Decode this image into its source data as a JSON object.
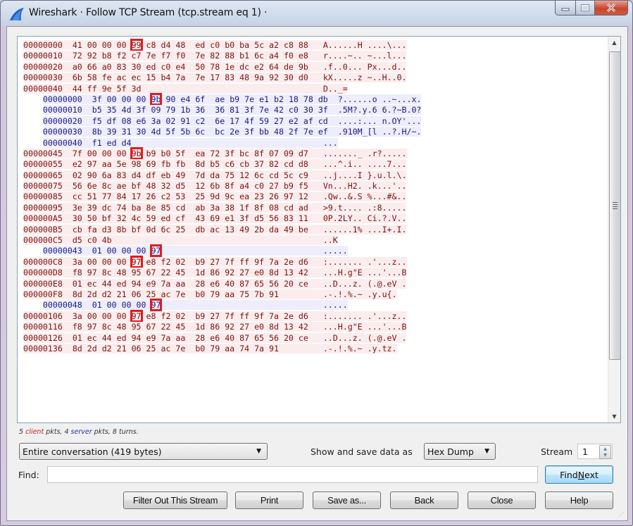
{
  "window": {
    "title": "Wireshark · Follow TCP Stream (tcp.stream eq 1) ·",
    "controls": {
      "minimize": "minimize",
      "maximize": "maximize",
      "close": "close"
    }
  },
  "colors": {
    "client_bg": "#fbeded",
    "client_text": "#7f1010",
    "server_bg": "#ededfb",
    "server_text": "#1a1a80",
    "highlight_box": "#e11b22"
  },
  "dump": {
    "lines": [
      {
        "side": "client",
        "offset": "00000000",
        "hex_pre": "41 00 00 00 ",
        "hl": "99",
        "hex_post": " c8 d4 48  ed c0 b0 ba 5c a2 c8 88",
        "ascii": "A......H ....\\..."
      },
      {
        "side": "client",
        "offset": "00000010",
        "hex_pre": "72 92 b8 f2 c7 7e f7 f0  7e 82 88 b1 6c a4 f0 e8",
        "hl": "",
        "hex_post": "",
        "ascii": "r....~.. ~...l..."
      },
      {
        "side": "client",
        "offset": "00000020",
        "hex_pre": "a0 66 a0 83 30 ed c0 e4  50 78 1e dc e2 64 de 9b",
        "hl": "",
        "hex_post": "",
        "ascii": ".f..0... Px...d.."
      },
      {
        "side": "client",
        "offset": "00000030",
        "hex_pre": "6b 58 fe ac ec 15 b4 7a  7e 17 83 48 9a 92 30 d0",
        "hl": "",
        "hex_post": "",
        "ascii": "kX.....z ~..H..0."
      },
      {
        "side": "client",
        "offset": "00000040",
        "hex_pre": "44 ff 9e 5f 3d",
        "hl": "",
        "hex_post": "",
        "ascii": "D.._="
      },
      {
        "side": "server",
        "offset": "00000000",
        "hex_pre": "3f 00 00 00 ",
        "hl": "9b",
        "hex_post": " 90 e4 6f  ae b9 7e e1 b2 18 78 db",
        "ascii": "?......o ..~...x."
      },
      {
        "side": "server",
        "offset": "00000010",
        "hex_pre": "b5 35 4d 3f 09 79 1b 36  36 81 3f 7e 42 c0 30 3f",
        "hl": "",
        "hex_post": "",
        "ascii": ".5M?.y.6 6.?~B.0?"
      },
      {
        "side": "server",
        "offset": "00000020",
        "hex_pre": "f5 df 08 e6 3a 02 91 c2  6e 17 4f 59 27 e2 af cd",
        "hl": "",
        "hex_post": "",
        "ascii": "....:... n.OY'..."
      },
      {
        "side": "server",
        "offset": "00000030",
        "hex_pre": "8b 39 31 30 4d 5f 5b 6c  bc 2e 3f bb 48 2f 7e ef",
        "hl": "",
        "hex_post": "",
        "ascii": ".910M_[l ..?.H/~."
      },
      {
        "side": "server",
        "offset": "00000040",
        "hex_pre": "f1 ed d4",
        "hl": "",
        "hex_post": "",
        "ascii": "..."
      },
      {
        "side": "client",
        "offset": "00000045",
        "hex_pre": "7f 00 00 00 ",
        "hl": "9b",
        "hex_post": " b9 b0 5f  ea 72 3f bc 8f 07 09 d7",
        "ascii": "......._ .r?....."
      },
      {
        "side": "client",
        "offset": "00000055",
        "hex_pre": "e2 97 aa 5e 98 69 fb fb  8d b5 c6 cb 37 82 cd d8",
        "hl": "",
        "hex_post": "",
        "ascii": "...^.i.. ....7..."
      },
      {
        "side": "client",
        "offset": "00000065",
        "hex_pre": "02 90 6a 83 d4 df eb 49  7d da 75 12 6c cd 5c c9",
        "hl": "",
        "hex_post": "",
        "ascii": "..j....I }.u.l.\\."
      },
      {
        "side": "client",
        "offset": "00000075",
        "hex_pre": "56 6e 8c ae bf 48 32 d5  12 6b 8f a4 c0 27 b9 f5",
        "hl": "",
        "hex_post": "",
        "ascii": "Vn...H2. .k...'.."
      },
      {
        "side": "client",
        "offset": "00000085",
        "hex_pre": "cc 51 77 84 17 26 c2 53  25 9d 9c ea 23 26 97 12",
        "hl": "",
        "hex_post": "",
        "ascii": ".Qw..&.S %...#&.."
      },
      {
        "side": "client",
        "offset": "00000095",
        "hex_pre": "3e 39 dc 74 ba 8e 85 cd  ab 3a 38 1f 8f 08 cd ad",
        "hl": "",
        "hex_post": "",
        "ascii": ">9.t.... .:8....."
      },
      {
        "side": "client",
        "offset": "000000A5",
        "hex_pre": "30 50 bf 32 4c 59 ed cf  43 69 e1 3f d5 56 83 11",
        "hl": "",
        "hex_post": "",
        "ascii": "0P.2LY.. Ci.?.V.."
      },
      {
        "side": "client",
        "offset": "000000B5",
        "hex_pre": "cb fa d3 8b bf 0d 6c 25  db ac 13 49 2b da 49 be",
        "hl": "",
        "hex_post": "",
        "ascii": "......1% ...I+.I."
      },
      {
        "side": "client",
        "offset": "000000C5",
        "hex_pre": "d5 c0 4b",
        "hl": "",
        "hex_post": "",
        "ascii": "..K"
      },
      {
        "side": "server",
        "offset": "00000043",
        "hex_pre": "01 00 00 00 ",
        "hl": "97",
        "hex_post": "",
        "ascii": "....."
      },
      {
        "side": "client",
        "offset": "000000C8",
        "hex_pre": "3a 00 00 00 ",
        "hl": "97",
        "hex_post": " e8 f2 02  b9 27 7f ff 9f 7a 2e d6",
        "ascii": ":....... .'...z.."
      },
      {
        "side": "client",
        "offset": "000000D8",
        "hex_pre": "f8 97 8c 48 95 67 22 45  1d 86 92 27 e0 8d 13 42",
        "hl": "",
        "hex_post": "",
        "ascii": "...H.g\"E ...'...B"
      },
      {
        "side": "client",
        "offset": "000000E8",
        "hex_pre": "01 ec 44 ed 94 e9 7a aa  28 e6 40 87 65 56 20 ce",
        "hl": "",
        "hex_post": "",
        "ascii": "..D...z. (.@.eV ."
      },
      {
        "side": "client",
        "offset": "000000F8",
        "hex_pre": "8d 2d d2 21 06 25 ac 7e  b0 79 aa 75 7b 91",
        "hl": "",
        "hex_post": "",
        "ascii": ".-.!.%.~ .y.u{."
      },
      {
        "side": "server",
        "offset": "00000048",
        "hex_pre": "01 00 00 00 ",
        "hl": "97",
        "hex_post": "",
        "ascii": "....."
      },
      {
        "side": "client",
        "offset": "00000106",
        "hex_pre": "3a 00 00 00 ",
        "hl": "97",
        "hex_post": " e8 f2 02  b9 27 7f ff 9f 7a 2e d6",
        "ascii": ":....... .'...z.."
      },
      {
        "side": "client",
        "offset": "00000116",
        "hex_pre": "f8 97 8c 48 95 67 22 45  1d 86 92 27 e0 8d 13 42",
        "hl": "",
        "hex_post": "",
        "ascii": "...H.g\"E ...'...B"
      },
      {
        "side": "client",
        "offset": "00000126",
        "hex_pre": "01 ec 44 ed 94 e9 7a aa  28 e6 40 87 65 56 20 ce",
        "hl": "",
        "hex_post": "",
        "ascii": "..D...z. (.@.eV ."
      },
      {
        "side": "client",
        "offset": "00000136",
        "hex_pre": "8d 2d d2 21 06 25 ac 7e  b0 79 aa 74 7a 91",
        "hl": "",
        "hex_post": "",
        "ascii": ".-.!.%.~ .y.tz."
      }
    ],
    "scroll_position_fraction": 0.0
  },
  "stats": {
    "client_count": "5",
    "client_word": "client",
    "pkts_1": "pkts,",
    "server_count": "4",
    "server_word": "server",
    "rest": "pkts, 8 turns."
  },
  "controls": {
    "conversation_select": "Entire conversation (419 bytes)",
    "show_as_label": "Show and save data as",
    "show_as_select": "Hex Dump",
    "stream_label": "Stream",
    "stream_value": "1",
    "find_label": "Find:",
    "find_value": "",
    "find_next_pre": "Find ",
    "find_next_mnemonic": "N",
    "find_next_post": "ext"
  },
  "buttons": {
    "filter_out": "Filter Out This Stream",
    "print": "Print",
    "save_as": "Save as...",
    "back": "Back",
    "close": "Close",
    "help": "Help"
  }
}
